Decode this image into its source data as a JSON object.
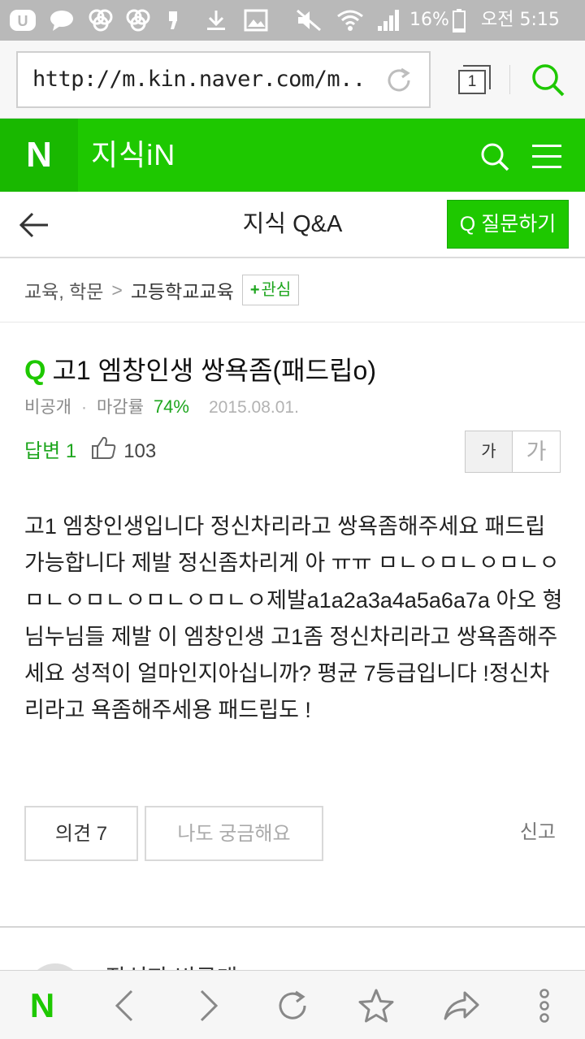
{
  "status_bar": {
    "battery": "16%",
    "time": "오전 5:15",
    "icons": [
      "nate-icon",
      "chat-bubble-icon",
      "cloud-icon",
      "cloud-icon",
      "quote-icon",
      "download-icon",
      "image-icon",
      "mute-icon",
      "wifi-icon",
      "signal-icon",
      "battery-icon"
    ]
  },
  "browser": {
    "url": "http://m.kin.naver.com/m...",
    "tab_count": "1"
  },
  "header": {
    "logo": "N",
    "service": "지식iN"
  },
  "subheader": {
    "title": "지식 Q&A",
    "ask_button": "Q 질문하기"
  },
  "breadcrumb": {
    "parent": "교육, 학문",
    "separator": ">",
    "current": "고등학교교육",
    "follow_plus": "+",
    "follow_label": "관심"
  },
  "question": {
    "mark": "Q",
    "title": "고1 엠창인생 쌍욕좀(패드립o)",
    "visibility": "비공개",
    "dot": "·",
    "close_rate_label": "마감률",
    "close_rate": "74%",
    "date": "2015.08.01.",
    "answers": "답변 1",
    "likes": "103",
    "body": "고1 엠창인생입니다 정신차리라고 쌍욕좀해주세요 패드립가능합니다 제발 정신좀차리게 아 ㅠㅠ ㅁㄴㅇㅁㄴㅇㅁㄴㅇㅁㄴㅇㅁㄴㅇㅁㄴㅇㅁㄴㅇ제발a1a2a3a4a5a6a7a 아오 형님누님들 제발 이 엠창인생 고1좀 정신차리라고 쌍욕좀해주세요 성적이 얼마인지아십니까? 평균 7등급입니다 !정신차리라고 욕좀해주세용 패드립도 !"
  },
  "font_size": {
    "small": "가",
    "large": "가"
  },
  "actions": {
    "opinion": "의견 7",
    "curious": "나도 궁금해요",
    "report": "신고"
  },
  "answer_peek": {
    "name": "작성자 비공개"
  },
  "toolbar": {
    "home": "N"
  }
}
